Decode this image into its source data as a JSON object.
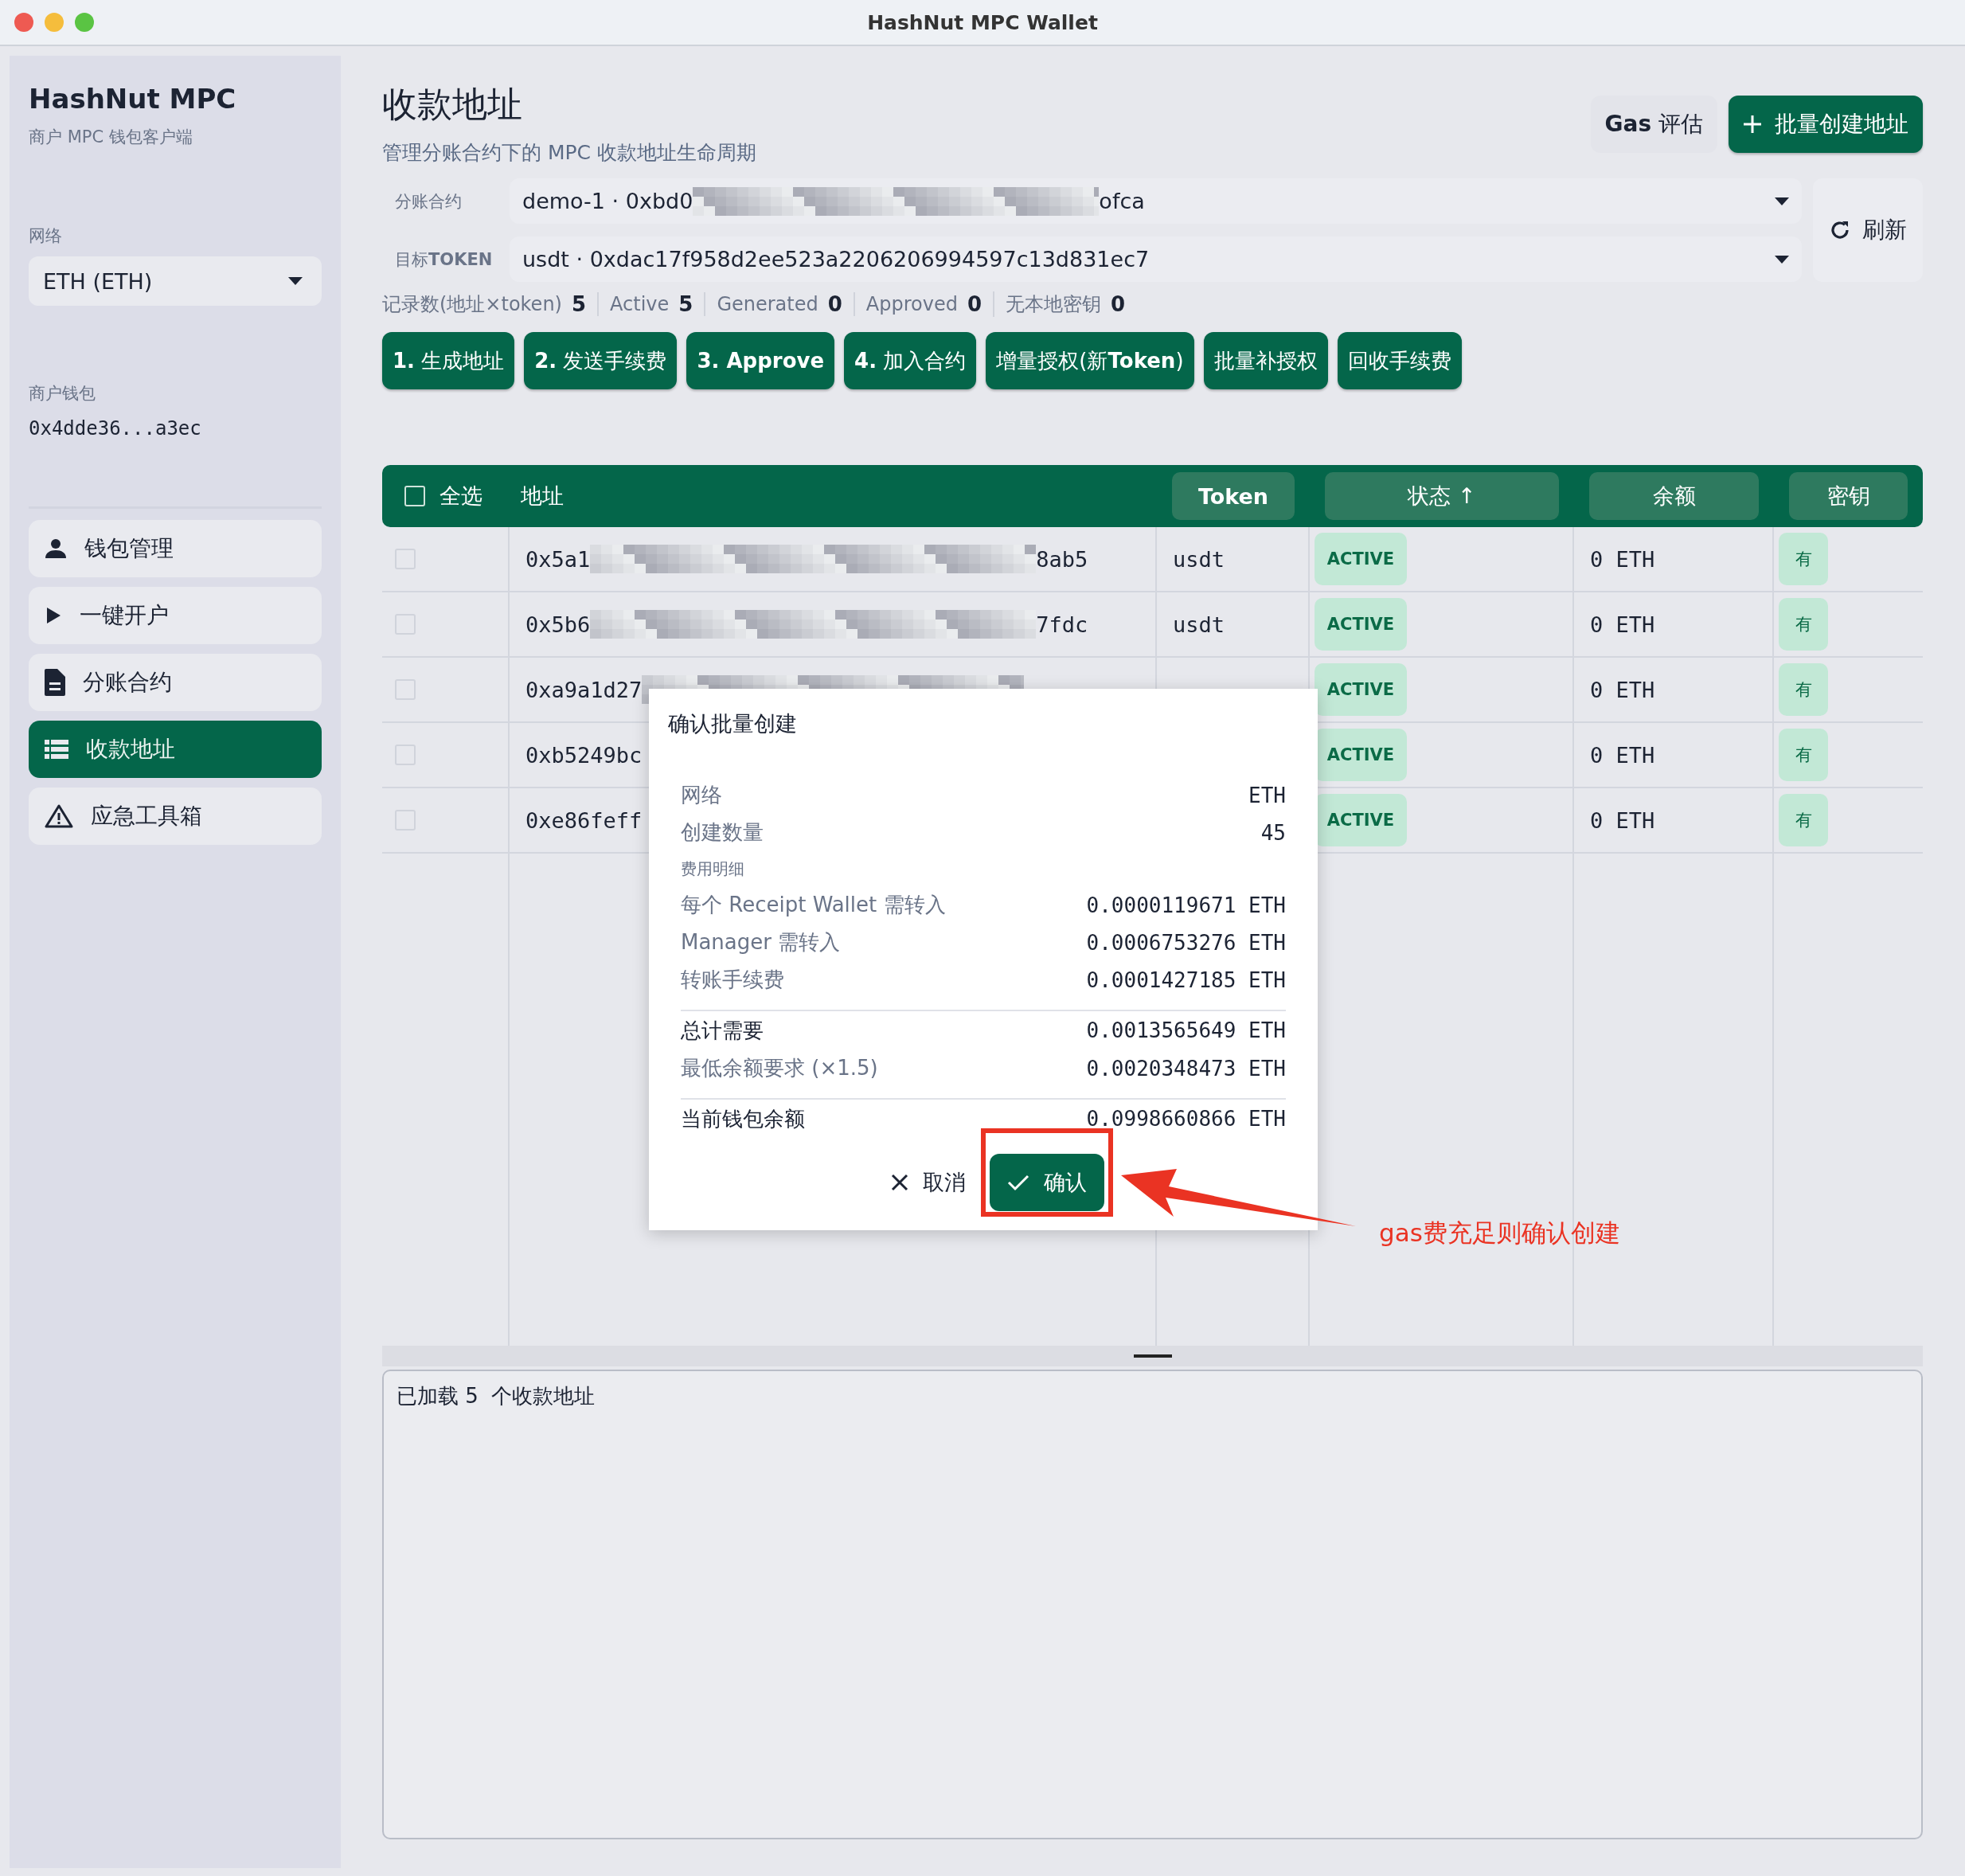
{
  "window": {
    "title": "HashNut MPC Wallet"
  },
  "sidebar": {
    "app_name": "HashNut MPC",
    "app_subtitle": "商户 MPC 钱包客户端",
    "network_label": "网络",
    "network_value": "ETH (ETH)",
    "wallet_label": "商户钱包",
    "wallet_address": "0x4dde36...a3ec",
    "nav": [
      {
        "label": "钱包管理",
        "selected": false
      },
      {
        "label": "一键开户",
        "selected": false
      },
      {
        "label": "分账合约",
        "selected": false
      },
      {
        "label": "收款地址",
        "selected": true
      },
      {
        "label": "应急工具箱",
        "selected": false
      }
    ]
  },
  "header": {
    "title": "收款地址",
    "subtitle": "管理分账合约下的 MPC 收款地址生命周期",
    "gas_button": "**Gas** 评估",
    "create_button": "批量创建地址",
    "refresh_button": "刷新"
  },
  "filters": [
    {
      "label": "分账合约",
      "value_start": "demo-1 · 0xbd0",
      "value_end": "ofca",
      "redacted": true
    },
    {
      "label": "目标**TOKEN**",
      "value_start": "usdt · 0xdac17f958d2ee523a2206206994597c13d831ec7",
      "redacted": false
    }
  ],
  "stats": [
    {
      "label": "记录数(地址×token)",
      "value": "5"
    },
    {
      "label": "Active",
      "value": "5"
    },
    {
      "label": "Generated",
      "value": "0"
    },
    {
      "label": "Approved",
      "value": "0"
    },
    {
      "label": "无本地密钥",
      "value": "0"
    }
  ],
  "actions": [
    "**1.** 生成地址",
    "**2.** 发送手续费",
    "**3. Approve**",
    "**4.** 加入合约",
    "增量授权(新**Token**)",
    "批量补授权",
    "回收手续费"
  ],
  "table": {
    "select_all": "全选",
    "select_all_checked": false,
    "columns": [
      "地址",
      "Token",
      "状态 ↑",
      "余额",
      "密钥"
    ],
    "rows": [
      {
        "checked": false,
        "address_start": "0x5a1",
        "address_end": "8ab5",
        "redacted": true,
        "token": "usdt",
        "status": "ACTIVE",
        "balance": "0 ETH",
        "key": "有"
      },
      {
        "checked": false,
        "address_start": "0x5b6",
        "address_end": "7fdc",
        "redacted": true,
        "token": "usdt",
        "status": "ACTIVE",
        "balance": "0 ETH",
        "key": "有"
      },
      {
        "checked": false,
        "address_start": "0xa9a1d27",
        "redacted": true,
        "status": "ACTIVE",
        "balance": "0 ETH",
        "key": "有"
      },
      {
        "checked": false,
        "address_start": "0xb5249bc",
        "redacted": false,
        "status": "ACTIVE",
        "balance": "0 ETH",
        "key": "有"
      },
      {
        "checked": false,
        "address_start": "0xe86feff",
        "redacted": false,
        "status": "ACTIVE",
        "balance": "0 ETH",
        "key": "有"
      }
    ]
  },
  "log": {
    "text": "已加载 5  个收款地址"
  },
  "dialog": {
    "title": "确认批量创建",
    "rows": [
      {
        "kind": "info",
        "label": "网络",
        "value": "ETH"
      },
      {
        "kind": "info",
        "label": "创建数量",
        "value": "45"
      },
      {
        "kind": "heading",
        "label": "费用明细"
      },
      {
        "kind": "info",
        "label": "每个 Receipt Wallet 需转入",
        "value": "0.0000119671 ETH"
      },
      {
        "kind": "info",
        "label": "Manager 需转入",
        "value": "0.0006753276 ETH"
      },
      {
        "kind": "info",
        "label": "转账手续费",
        "value": "0.0001427185 ETH"
      },
      {
        "kind": "total",
        "label": "总计需要",
        "value": "0.0013565649 ETH"
      },
      {
        "kind": "info",
        "label": "最低余额要求 (×1.5)",
        "value": "0.0020348473 ETH"
      },
      {
        "kind": "total",
        "label": "当前钱包余额",
        "value": "0.0998660866 ETH"
      }
    ],
    "cancel_button": "取消",
    "confirm_button": "确认"
  },
  "annotation": {
    "text": "gas费充足则确认创建"
  }
}
